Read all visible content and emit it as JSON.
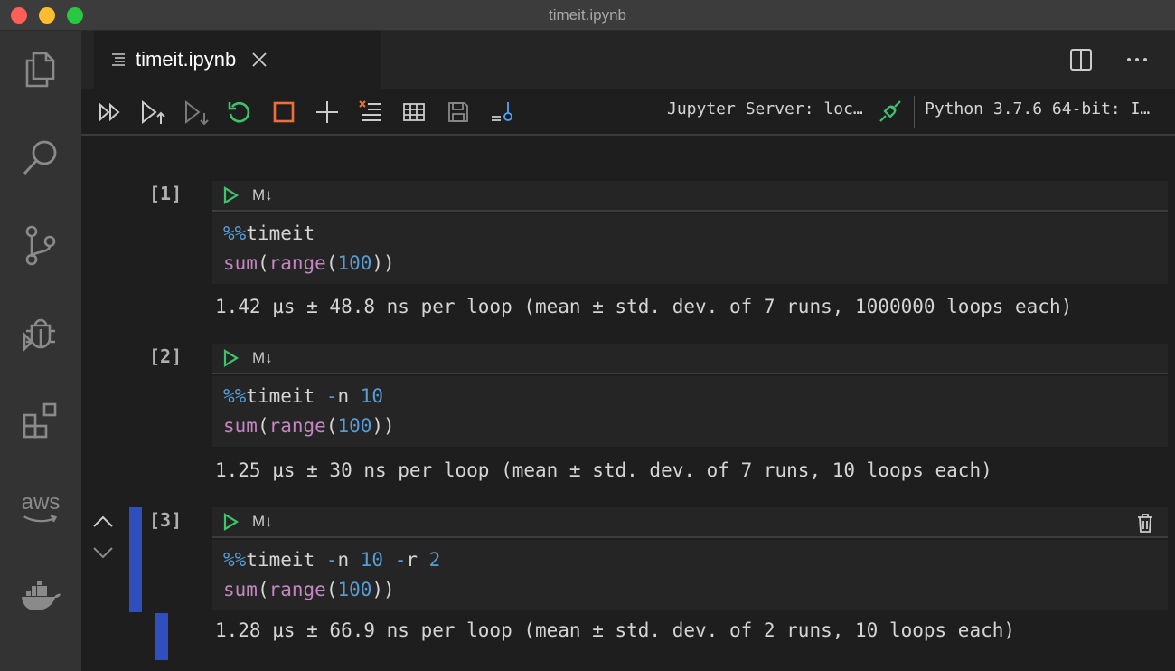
{
  "window": {
    "title": "timeit.ipynb"
  },
  "activity_bar": {
    "items": [
      "explorer-icon",
      "search-icon",
      "source-control-icon",
      "debug-icon",
      "extensions-icon",
      "aws-icon",
      "docker-icon"
    ],
    "aws_label": "aws"
  },
  "tab": {
    "title": "timeit.ipynb"
  },
  "toolbar": {
    "server_label": "Jupyter Server: loc…",
    "kernel_label": "Python 3.7.6 64-bit: I…"
  },
  "cells": [
    {
      "exec_count": "[1]",
      "markdown_toggle": "M↓",
      "code": [
        [
          {
            "t": "%%",
            "c": "magic"
          },
          {
            "t": "timeit",
            "c": "plain"
          }
        ],
        [
          {
            "t": "sum",
            "c": "fn"
          },
          {
            "t": "(",
            "c": "plain"
          },
          {
            "t": "range",
            "c": "fn"
          },
          {
            "t": "(",
            "c": "plain"
          },
          {
            "t": "100",
            "c": "num"
          },
          {
            "t": "))",
            "c": "plain"
          }
        ]
      ],
      "output": "1.42 µs ± 48.8 ns per loop (mean ± std. dev. of 7 runs, 1000000 loops each)"
    },
    {
      "exec_count": "[2]",
      "markdown_toggle": "M↓",
      "code": [
        [
          {
            "t": "%%",
            "c": "magic"
          },
          {
            "t": "timeit ",
            "c": "plain"
          },
          {
            "t": "-",
            "c": "magic"
          },
          {
            "t": "n ",
            "c": "plain"
          },
          {
            "t": "10",
            "c": "num"
          }
        ],
        [
          {
            "t": "sum",
            "c": "fn"
          },
          {
            "t": "(",
            "c": "plain"
          },
          {
            "t": "range",
            "c": "fn"
          },
          {
            "t": "(",
            "c": "plain"
          },
          {
            "t": "100",
            "c": "num"
          },
          {
            "t": "))",
            "c": "plain"
          }
        ]
      ],
      "output": "1.25 µs ± 30 ns per loop (mean ± std. dev. of 7 runs, 10 loops each)"
    },
    {
      "exec_count": "[3]",
      "markdown_toggle": "M↓",
      "code": [
        [
          {
            "t": "%%",
            "c": "magic"
          },
          {
            "t": "timeit ",
            "c": "plain"
          },
          {
            "t": "-",
            "c": "magic"
          },
          {
            "t": "n ",
            "c": "plain"
          },
          {
            "t": "10",
            "c": "num"
          },
          {
            "t": " ",
            "c": "plain"
          },
          {
            "t": "-",
            "c": "magic"
          },
          {
            "t": "r ",
            "c": "plain"
          },
          {
            "t": "2",
            "c": "num"
          }
        ],
        [
          {
            "t": "sum",
            "c": "fn"
          },
          {
            "t": "(",
            "c": "plain"
          },
          {
            "t": "range",
            "c": "fn"
          },
          {
            "t": "(",
            "c": "plain"
          },
          {
            "t": "100",
            "c": "num"
          },
          {
            "t": "))",
            "c": "plain"
          }
        ]
      ],
      "output": "1.28 µs ± 66.9 ns per loop (mean ± std. dev. of 2 runs, 10 loops each)"
    }
  ],
  "colors": {
    "accent_green": "#3ec26b",
    "stop_orange": "#f06e3c",
    "selection_blue": "#2f4fbf"
  }
}
